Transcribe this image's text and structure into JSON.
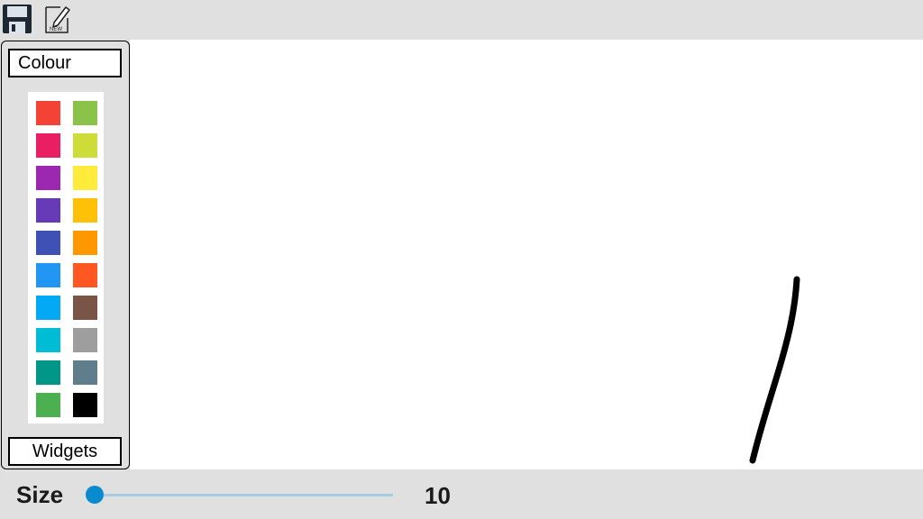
{
  "toolbar": {
    "save_icon": "floppy-disk-icon",
    "new_icon": "new-document-icon",
    "new_badge": "NEW"
  },
  "side_panel": {
    "colour_label": "Colour",
    "widgets_label": "Widgets",
    "palette": [
      [
        "#f44336",
        "#8bc34a"
      ],
      [
        "#e91e63",
        "#cddc39"
      ],
      [
        "#9c27b0",
        "#ffeb3b"
      ],
      [
        "#673ab7",
        "#ffc107"
      ],
      [
        "#3f51b5",
        "#ff9800"
      ],
      [
        "#2196f3",
        "#ff5722"
      ],
      [
        "#03a9f4",
        "#795548"
      ],
      [
        "#00bcd4",
        "#9e9e9e"
      ],
      [
        "#009688",
        "#607d8b"
      ],
      [
        "#4caf50",
        "#000000"
      ]
    ]
  },
  "canvas": {
    "stroke_color": "#000000"
  },
  "bottom_bar": {
    "size_label": "Size",
    "size_value": "10",
    "slider_fraction": 0.0,
    "slider_accent": "#0a8bd0"
  }
}
